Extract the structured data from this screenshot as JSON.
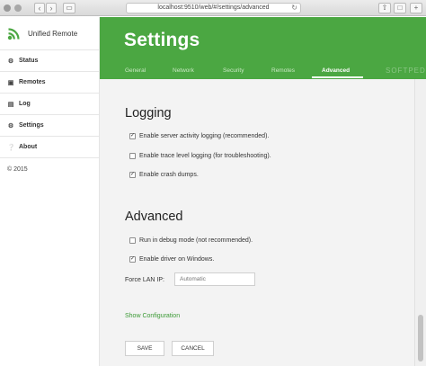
{
  "browser": {
    "url": "localhost:9510/web/#/settings/advanced"
  },
  "sidebar": {
    "brand": "Unified Remote",
    "items": [
      {
        "label": "Status",
        "icon": "gear-icon"
      },
      {
        "label": "Remotes",
        "icon": "gamepad-icon"
      },
      {
        "label": "Log",
        "icon": "document-icon"
      },
      {
        "label": "Settings",
        "icon": "gear-icon"
      },
      {
        "label": "About",
        "icon": "help-icon"
      }
    ],
    "copyright": "© 2015"
  },
  "header": {
    "title": "Settings",
    "tabs": [
      "General",
      "Network",
      "Security",
      "Remotes",
      "Advanced"
    ],
    "active_tab": "Advanced",
    "watermark": "SOFTPEDIA"
  },
  "logging": {
    "title": "Logging",
    "options": [
      {
        "label": "Enable server activity logging (recommended).",
        "checked": true
      },
      {
        "label": "Enable trace level logging (for troubleshooting).",
        "checked": false
      },
      {
        "label": "Enable crash dumps.",
        "checked": true
      }
    ]
  },
  "advanced": {
    "title": "Advanced",
    "options": [
      {
        "label": "Run in debug mode (not recommended).",
        "checked": false
      },
      {
        "label": "Enable driver on Windows.",
        "checked": true
      }
    ],
    "lan_ip_label": "Force LAN IP:",
    "lan_ip_value": "",
    "lan_ip_placeholder": "Automatic"
  },
  "show_config": "Show Configuration",
  "buttons": {
    "save": "SAVE",
    "cancel": "CANCEL"
  },
  "colors": {
    "brand_green": "#4ba742",
    "link_green": "#3c9a36"
  }
}
